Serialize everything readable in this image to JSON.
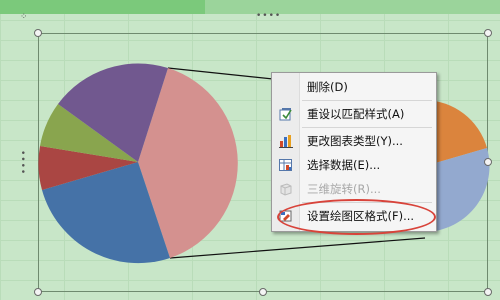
{
  "context_menu": {
    "items": [
      {
        "label": "删除(D)",
        "icon": "delete-icon",
        "enabled": true
      },
      {
        "label": "重设以匹配样式(A)",
        "icon": "reset-style-icon",
        "enabled": true
      },
      {
        "label": "更改图表类型(Y)...",
        "icon": "chart-type-icon",
        "enabled": true
      },
      {
        "label": "选择数据(E)...",
        "icon": "select-data-icon",
        "enabled": true
      },
      {
        "label": "三维旋转(R)...",
        "icon": "3d-rotation-icon",
        "enabled": false
      },
      {
        "label": "设置绘图区格式(F)...",
        "icon": "format-plot-area-icon",
        "enabled": true
      }
    ]
  },
  "colors": {
    "background": "#c8e6c8",
    "slice_pink": "#d4918f",
    "slice_blue": "#4572a7",
    "slice_red": "#aa4643",
    "slice_green": "#89a54e",
    "slice_purple": "#71588f",
    "slice_orange": "#db843d",
    "slice_lightblue": "#93a9cf",
    "annotation": "#d8433a"
  }
}
